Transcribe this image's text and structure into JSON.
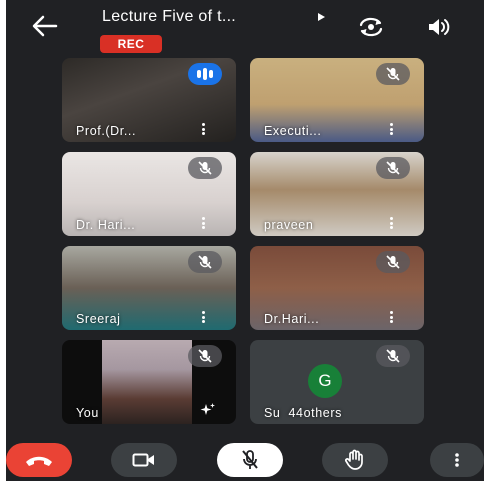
{
  "header": {
    "title": "Lecture Five of t...",
    "rec_label": "REC"
  },
  "icons": {
    "back": "arrow-left-icon",
    "title_expand": "play-arrow-icon",
    "camera_switch": "switch-camera-icon",
    "speaker": "speaker-icon"
  },
  "participants": [
    {
      "name": "Prof.(Dr...",
      "status": "speaking"
    },
    {
      "name": "Executi...",
      "status": "muted"
    },
    {
      "name": "Dr. Hari...",
      "status": "muted"
    },
    {
      "name": "praveen",
      "status": "muted"
    },
    {
      "name": "Sreeraj",
      "status": "muted"
    },
    {
      "name": "Dr.Hari...",
      "status": "muted"
    },
    {
      "name": "You",
      "status": "muted"
    }
  ],
  "others_tile": {
    "avatar_letter": "G",
    "label": "Su",
    "count": "44",
    "others_text": "others"
  },
  "controls": {
    "hangup": "call-end-icon",
    "camera": "videocam-icon",
    "mic": "mic-off-icon",
    "hand": "raise-hand-icon",
    "more": "more-vert-icon"
  },
  "colors": {
    "background": "#202124",
    "rec": "#d93025",
    "hangup": "#ea4335",
    "speaking": "#1a73e8",
    "avatar": "#188038"
  }
}
